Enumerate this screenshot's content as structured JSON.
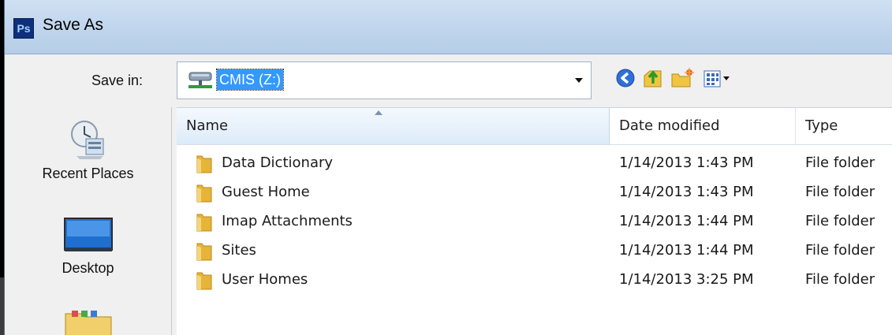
{
  "window": {
    "app_badge": "Ps",
    "title": "Save As"
  },
  "save_in": {
    "label": "Save in:",
    "value": "CMIS (Z:)"
  },
  "toolbar": {
    "icons": [
      "back-icon",
      "up-folder-icon",
      "new-folder-icon",
      "view-menu-icon"
    ]
  },
  "places": [
    {
      "label": "Recent Places",
      "icon": "recent-places-icon"
    },
    {
      "label": "Desktop",
      "icon": "desktop-icon"
    },
    {
      "label": "",
      "icon": "libraries-icon"
    }
  ],
  "columns": {
    "name": "Name",
    "date": "Date modified",
    "type": "Type"
  },
  "files": [
    {
      "name": "Data Dictionary",
      "date": "1/14/2013 1:43 PM",
      "type": "File folder"
    },
    {
      "name": "Guest Home",
      "date": "1/14/2013 1:43 PM",
      "type": "File folder"
    },
    {
      "name": "Imap Attachments",
      "date": "1/14/2013 1:44 PM",
      "type": "File folder"
    },
    {
      "name": "Sites",
      "date": "1/14/2013 1:44 PM",
      "type": "File folder"
    },
    {
      "name": "User Homes",
      "date": "1/14/2013 3:25 PM",
      "type": "File folder"
    }
  ],
  "colors": {
    "selection": "#3399ff",
    "titlebar": "#c2d7ee",
    "dialog_bg": "#f0f0f0"
  }
}
